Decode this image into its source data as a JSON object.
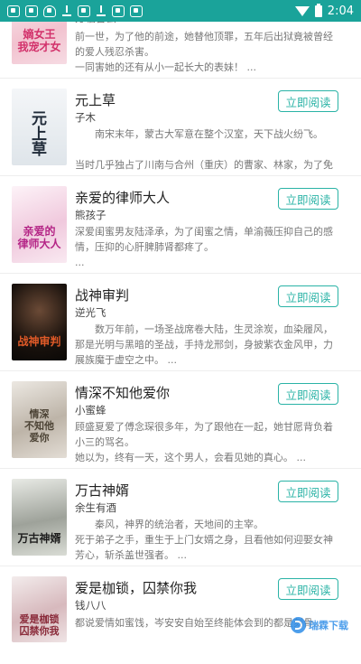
{
  "status_bar": {
    "time": "2:04",
    "notification_icons": [
      "app-notification-icon",
      "app-notification-icon",
      "shield-icon",
      "download-icon",
      "app-notification-icon",
      "download-icon",
      "app-notification-icon",
      "app-notification-icon"
    ],
    "accent": "#1aa39a"
  },
  "read_button_label": "立即阅读",
  "books": [
    {
      "title": "",
      "author": "方临言云",
      "cover_text": "嫡女王\n我宠才女",
      "cover_colors": [
        "#f7e0e6",
        "#e07c96"
      ],
      "description": "前一世，为了他的前途，她替他顶罪，五年后出狱竟被曾经的爱人残忍杀害。\n一同害她的还有从小一起长大的表妹！ ..."
    },
    {
      "title": "元上草",
      "author": "子木",
      "cover_text": "元上草",
      "cover_colors": [
        "#e9eef2",
        "#2a3140"
      ],
      "description": "南宋末年，蒙古大军意在整个汉室，天下战火纷飞。\n\n当时几乎独占了川南与合州（重庆）的曹家、林家，为了免受蒙..."
    },
    {
      "title": "亲爱的律师大人",
      "author": "熊孩子",
      "cover_text": "亲爱的\n律师大人",
      "cover_colors": [
        "#f6e3ef",
        "#b43c8c"
      ],
      "description": "深爱闺蜜男友陆泽承，为了闺蜜之情，单渝薇压抑自己的感情，压抑的心肝脾肺肾都疼了。\n..."
    },
    {
      "title": "战神审判",
      "author": "逆光飞",
      "cover_text": "战神审判",
      "cover_colors": [
        "#3a2a22",
        "#0c0a08"
      ],
      "description": "数万年前，一场圣战席卷大陆，生灵涂炭，血染履风，那是光明与黑暗的圣战，手持龙邢剑，身披紫衣金风甲，力展族魔于虚空之中。 ..."
    },
    {
      "title": "情深不知他爱你",
      "author": "小蜜蜂",
      "cover_text": "情深\n不知他\n爱你",
      "cover_colors": [
        "#dcd6ce",
        "#7a7060"
      ],
      "description": "顾盛夏爱了傅念琛很多年，为了跟他在一起，她甘愿背负着小三的骂名。\n她以为，终有一天，这个男人，会看见她的真心。 ..."
    },
    {
      "title": "万古神婿",
      "author": "余生有酒",
      "cover_text": "万古神婿",
      "cover_colors": [
        "#c9ccc6",
        "#2b2b2b"
      ],
      "description": "秦风，神界的统治者，天地间的主宰。\n死于弟子之手，重生于上门女婿之身，且看他如何迎娶女神芳心，斩杀盖世强者。 ..."
    },
    {
      "title": "爱是枷锁，囚禁你我",
      "author": "钱八八",
      "cover_text": "爱是枷锁\n囚禁你我",
      "cover_colors": [
        "#eadfe0",
        "#a04a55"
      ],
      "description": "都说爱情如蜜饯，岑安安自始至终能体会到的都是刻骨..."
    }
  ],
  "watermark": "瑞霖下载"
}
